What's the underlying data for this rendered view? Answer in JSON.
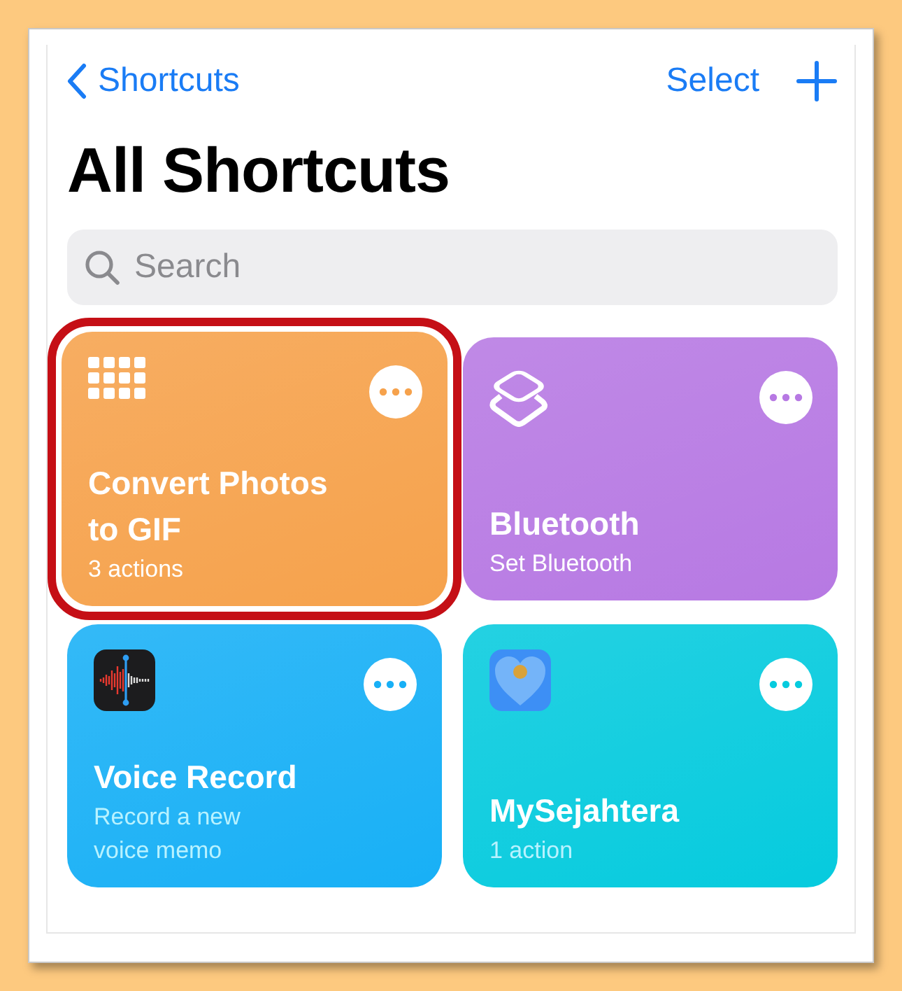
{
  "nav": {
    "back": "Shortcuts",
    "select": "Select"
  },
  "title": "All Shortcuts",
  "search": {
    "placeholder": "Search"
  },
  "cards": [
    {
      "title": "Convert Photos to GIF",
      "subtitle": "3 actions",
      "color": "#f6a24c",
      "highlighted": true
    },
    {
      "title": "Bluetooth",
      "subtitle": "Set Bluetooth",
      "color": "#b779e3",
      "highlighted": false
    },
    {
      "title": "Voice Record",
      "subtitle": "Record a new voice memo",
      "color": "#18b0f6",
      "highlighted": false
    },
    {
      "title": "MySejahtera",
      "subtitle": "1 action",
      "color": "#06cbde",
      "highlighted": false
    }
  ]
}
